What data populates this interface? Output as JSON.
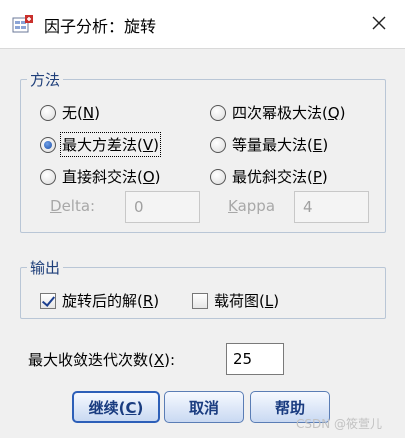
{
  "window": {
    "title": "因子分析：旋转"
  },
  "method": {
    "legend": "方法",
    "options": [
      {
        "id": "none",
        "label": "无(",
        "key": "N",
        "suffix": ")",
        "selected": false
      },
      {
        "id": "varimax",
        "label": "最大方差法(",
        "key": "V",
        "suffix": ")",
        "selected": true
      },
      {
        "id": "oblimin",
        "label": "直接斜交法(",
        "key": "O",
        "suffix": ")",
        "selected": false
      },
      {
        "id": "quartimax",
        "label": "四次幂极大法(",
        "key": "Q",
        "suffix": ")",
        "selected": false
      },
      {
        "id": "equamax",
        "label": "等量最大法(",
        "key": "E",
        "suffix": ")",
        "selected": false
      },
      {
        "id": "promax",
        "label": "最优斜交法(",
        "key": "P",
        "suffix": ")",
        "selected": false
      }
    ],
    "delta": {
      "label_pre": "",
      "key": "D",
      "label_post": "elta:",
      "value": "0"
    },
    "kappa": {
      "label_pre": "",
      "key": "K",
      "label_post": "appa",
      "value": "4"
    }
  },
  "output": {
    "legend": "输出",
    "rotated_solution": {
      "label": "旋转后的解(",
      "key": "R",
      "suffix": ")",
      "checked": true
    },
    "loading_plot": {
      "label": "载荷图(",
      "key": "L",
      "suffix": ")",
      "checked": false
    }
  },
  "iterations": {
    "label": "最大收敛迭代次数(",
    "key": "X",
    "suffix": "):",
    "value": "25"
  },
  "buttons": {
    "continue": {
      "label": "继续(",
      "key": "C",
      "suffix": ")"
    },
    "cancel": {
      "label": "取消"
    },
    "help": {
      "label": "帮助"
    }
  },
  "watermark": "CSDN @筱萱儿",
  "colors": {
    "accent": "#2d5fb8",
    "group_border": "#b9c6d6",
    "legend_text": "#1f3f7a"
  }
}
